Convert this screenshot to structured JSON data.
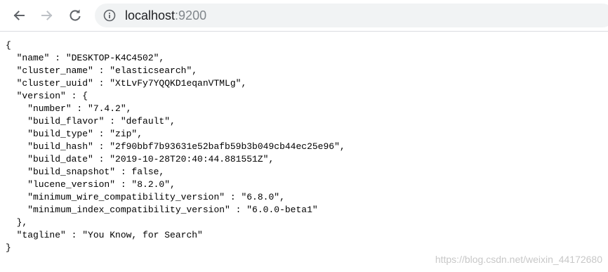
{
  "browser": {
    "url_host": "localhost",
    "url_port": ":9200"
  },
  "json_lines": [
    "{",
    "  \"name\" : \"DESKTOP-K4C4502\",",
    "  \"cluster_name\" : \"elasticsearch\",",
    "  \"cluster_uuid\" : \"XtLvFy7YQQKD1eqanVTMLg\",",
    "  \"version\" : {",
    "    \"number\" : \"7.4.2\",",
    "    \"build_flavor\" : \"default\",",
    "    \"build_type\" : \"zip\",",
    "    \"build_hash\" : \"2f90bbf7b93631e52bafb59b3b049cb44ec25e96\",",
    "    \"build_date\" : \"2019-10-28T20:40:44.881551Z\",",
    "    \"build_snapshot\" : false,",
    "    \"lucene_version\" : \"8.2.0\",",
    "    \"minimum_wire_compatibility_version\" : \"6.8.0\",",
    "    \"minimum_index_compatibility_version\" : \"6.0.0-beta1\"",
    "  },",
    "  \"tagline\" : \"You Know, for Search\"",
    "}"
  ],
  "watermark": "https://blog.csdn.net/weixin_44172680",
  "icons": {
    "back": "arrow-left-icon",
    "forward": "arrow-right-icon",
    "reload": "reload-icon",
    "info": "info-circle-icon"
  },
  "colors": {
    "toolbar_bg": "#ffffff",
    "omnibox_bg": "#f1f3f4",
    "icon_active": "#5f6368",
    "icon_disabled": "#bdc1c6",
    "port_text": "#80868b"
  }
}
